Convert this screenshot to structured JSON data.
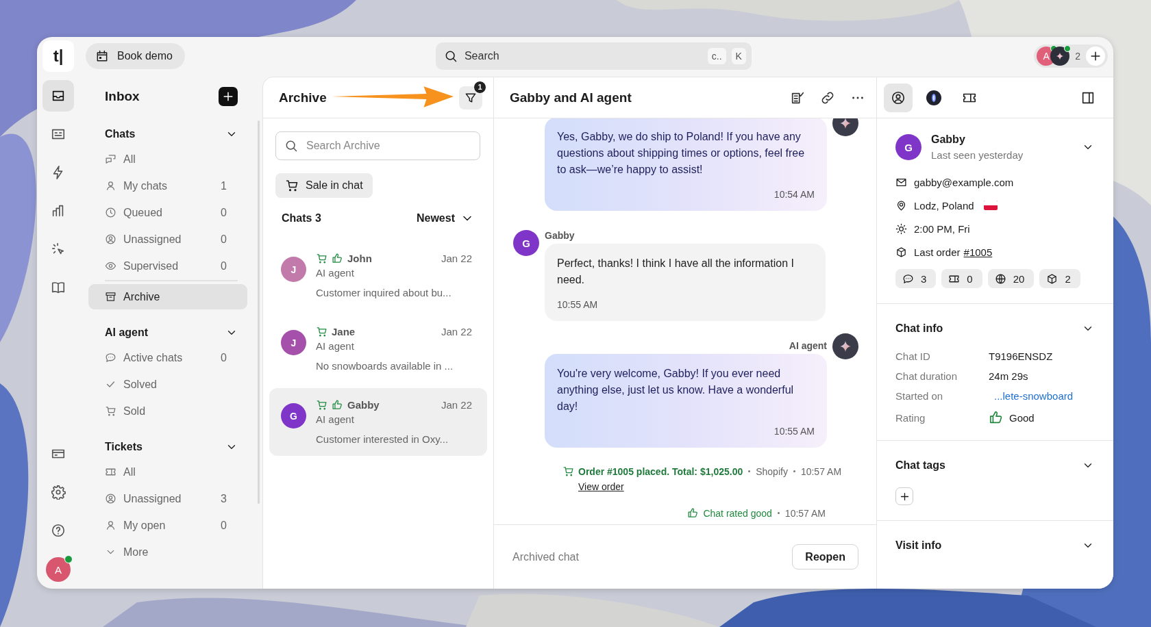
{
  "topbar": {
    "logo": "t|",
    "book_demo": "Book demo",
    "search": {
      "placeholder": "Search",
      "keys": [
        "c..",
        "K"
      ]
    },
    "agents": [
      {
        "kind": "human",
        "initial": "A",
        "online": true
      },
      {
        "kind": "ai",
        "online": true
      }
    ],
    "agent_count": "2"
  },
  "rail": {
    "items": [
      {
        "selected": true
      },
      {
        "selected": false
      },
      {
        "selected": false
      },
      {
        "selected": false
      },
      {
        "selected": false
      },
      {
        "selected": false
      }
    ],
    "user": {
      "initial": "A",
      "online": true
    }
  },
  "nav": {
    "title": "Inbox",
    "sections": [
      {
        "title": "Chats",
        "items": [
          {
            "label": "All",
            "selected": false
          },
          {
            "label": "My chats",
            "count": "1",
            "selected": false
          },
          {
            "label": "Queued",
            "count": "0",
            "selected": false
          },
          {
            "label": "Unassigned",
            "count": "0",
            "selected": false
          },
          {
            "label": "Supervised",
            "count": "0",
            "selected": false
          },
          {
            "label": "Archive",
            "selected": true
          }
        ]
      },
      {
        "title": "AI agent",
        "items": [
          {
            "label": "Active chats",
            "count": "0",
            "selected": false
          },
          {
            "label": "Solved",
            "selected": false
          },
          {
            "label": "Sold",
            "selected": false
          }
        ]
      },
      {
        "title": "Tickets",
        "items": [
          {
            "label": "All",
            "selected": false
          },
          {
            "label": "Unassigned",
            "count": "3",
            "selected": false
          },
          {
            "label": "My open",
            "count": "0",
            "selected": false
          },
          {
            "label": "More",
            "selected": false
          }
        ]
      }
    ]
  },
  "archive": {
    "title": "Archive",
    "filter_count": "1",
    "search": {
      "placeholder": "Search Archive"
    },
    "chip": "Sale in chat",
    "count_label": "Chats 3",
    "sort": "Newest",
    "chats": [
      {
        "initial": "J",
        "color": "#c27aab",
        "name": "John",
        "date": "Jan 22",
        "agent": "AI agent",
        "preview": "Customer inquired about bu...",
        "sale": true,
        "rated_good": true,
        "selected": false
      },
      {
        "initial": "J",
        "color": "#a550aa",
        "name": "Jane",
        "date": "Jan 22",
        "agent": "AI agent",
        "preview": "No snowboards available in ...",
        "sale": true,
        "rated_good": false,
        "selected": false
      },
      {
        "initial": "G",
        "color": "#7f35c8",
        "name": "Gabby",
        "date": "Jan 22",
        "agent": "AI agent",
        "preview": "Customer interested in Oxy...",
        "sale": true,
        "rated_good": true,
        "selected": true
      }
    ]
  },
  "chat": {
    "title": "Gabby and AI agent",
    "messages": [
      {
        "kind": "ai",
        "text": "Yes, Gabby, we do ship to Poland! If you have any questions about shipping times or options, feel free to ask—we’re happy to assist!",
        "time": "10:54 AM"
      },
      {
        "kind": "customer",
        "author": "Gabby",
        "initial": "G",
        "text": "Perfect, thanks! I think I have all the information I need.",
        "time": "10:55 AM"
      },
      {
        "kind": "ai",
        "author": "AI agent",
        "text": "You're very welcome, Gabby! If you ever need anything else, just let us know. Have a wonderful day!",
        "time": "10:55 AM"
      }
    ],
    "events": [
      {
        "kind": "order",
        "text": "Order #1005 placed. Total: $1,025.00",
        "source": "Shopify",
        "time": "10:57 AM",
        "link": "View order"
      },
      {
        "kind": "rating",
        "text": "Chat rated good",
        "time": "10:57 AM"
      }
    ],
    "footer": {
      "status": "Archived chat",
      "button": "Reopen"
    }
  },
  "details": {
    "tabs": [
      {
        "selected": true
      },
      {
        "selected": false
      },
      {
        "selected": false
      }
    ],
    "contact": {
      "initial": "G",
      "name": "Gabby",
      "last_seen": "Last seen yesterday",
      "email": "gabby@example.com",
      "location": "Lodz, Poland",
      "local_time": "2:00 PM, Fri",
      "last_order_label": "Last order",
      "last_order": "#1005"
    },
    "stats": [
      "3",
      "0",
      "20",
      "2"
    ],
    "chat_info": {
      "title": "Chat info",
      "rows": [
        {
          "label": "Chat ID",
          "value": "T9196ENSDZ"
        },
        {
          "label": "Chat duration",
          "value": "24m 29s"
        },
        {
          "label": "Started on",
          "value": "...lete-snowboard",
          "kind": "link"
        },
        {
          "label": "Rating",
          "value": "Good",
          "kind": "rating"
        }
      ]
    },
    "chat_tags": {
      "title": "Chat tags"
    },
    "visit_info": {
      "title": "Visit info"
    }
  }
}
